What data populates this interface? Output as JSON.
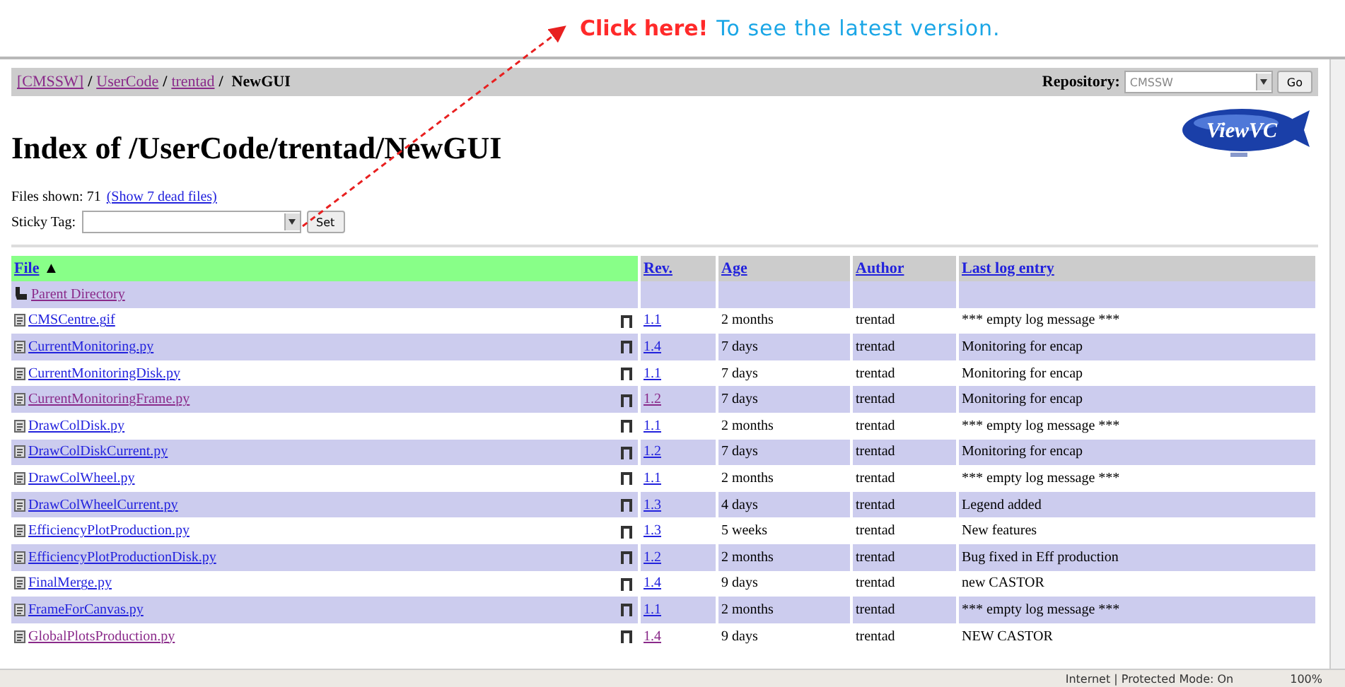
{
  "callout": {
    "action": "Click here!",
    "message": "To see the latest version."
  },
  "breadcrumb": [
    {
      "label": "[CMSSW]",
      "link": true
    },
    {
      "label": "/",
      "link": false
    },
    {
      "label": "UserCode",
      "link": true
    },
    {
      "label": "/",
      "link": false
    },
    {
      "label": "trentad",
      "link": true
    },
    {
      "label": "/",
      "link": false
    },
    {
      "label": "NewGUI",
      "link": false
    }
  ],
  "logo": "ViewVC",
  "repository": {
    "label": "Repository:",
    "value": "CMSSW",
    "button": "Go"
  },
  "title": "Index of /UserCode/trentad/NewGUI",
  "files_shown": {
    "label": "Files shown: 71",
    "link": "(Show 7 dead files)"
  },
  "sticky_tag": {
    "label": "Sticky Tag:",
    "button": "Set"
  },
  "table": {
    "columns": [
      {
        "label": "File",
        "sort_mark": "▲",
        "sorted": true
      },
      {
        "label": "Rev.",
        "sorted": false
      },
      {
        "label": "Age",
        "sorted": false
      },
      {
        "label": "Author",
        "sorted": false
      },
      {
        "label": "Last log entry",
        "sorted": false
      }
    ],
    "parent": "Parent Directory",
    "rows": [
      {
        "file": "CMSCentre.gif",
        "visited": false,
        "rev": "1.1",
        "age": "2 months",
        "author": "trentad",
        "log": "*** empty log message ***"
      },
      {
        "file": "CurrentMonitoring.py",
        "visited": false,
        "rev": "1.4",
        "age": "7 days",
        "author": "trentad",
        "log": "Monitoring for encap"
      },
      {
        "file": "CurrentMonitoringDisk.py",
        "visited": false,
        "rev": "1.1",
        "age": "7 days",
        "author": "trentad",
        "log": "Monitoring for encap"
      },
      {
        "file": "CurrentMonitoringFrame.py",
        "visited": true,
        "rev": "1.2",
        "age": "7 days",
        "author": "trentad",
        "log": "Monitoring for encap"
      },
      {
        "file": "DrawColDisk.py",
        "visited": false,
        "rev": "1.1",
        "age": "2 months",
        "author": "trentad",
        "log": "*** empty log message ***"
      },
      {
        "file": "DrawColDiskCurrent.py",
        "visited": false,
        "rev": "1.2",
        "age": "7 days",
        "author": "trentad",
        "log": "Monitoring for encap"
      },
      {
        "file": "DrawColWheel.py",
        "visited": false,
        "rev": "1.1",
        "age": "2 months",
        "author": "trentad",
        "log": "*** empty log message ***"
      },
      {
        "file": "DrawColWheelCurrent.py",
        "visited": false,
        "rev": "1.3",
        "age": "4 days",
        "author": "trentad",
        "log": "Legend added"
      },
      {
        "file": "EfficiencyPlotProduction.py",
        "visited": false,
        "rev": "1.3",
        "age": "5 weeks",
        "author": "trentad",
        "log": "New features"
      },
      {
        "file": "EfficiencyPlotProductionDisk.py",
        "visited": false,
        "rev": "1.2",
        "age": "2 months",
        "author": "trentad",
        "log": "Bug fixed in Eff production"
      },
      {
        "file": "FinalMerge.py",
        "visited": false,
        "rev": "1.4",
        "age": "9 days",
        "author": "trentad",
        "log": "new CASTOR"
      },
      {
        "file": "FrameForCanvas.py",
        "visited": false,
        "rev": "1.1",
        "age": "2 months",
        "author": "trentad",
        "log": "*** empty log message ***"
      },
      {
        "file": "GlobalPlotsProduction.py",
        "visited": true,
        "rev": "1.4",
        "age": "9 days",
        "author": "trentad",
        "log": "NEW CASTOR"
      }
    ]
  },
  "status_bar": {
    "zone": "Internet | Protected Mode: On",
    "zoom": "100%"
  }
}
